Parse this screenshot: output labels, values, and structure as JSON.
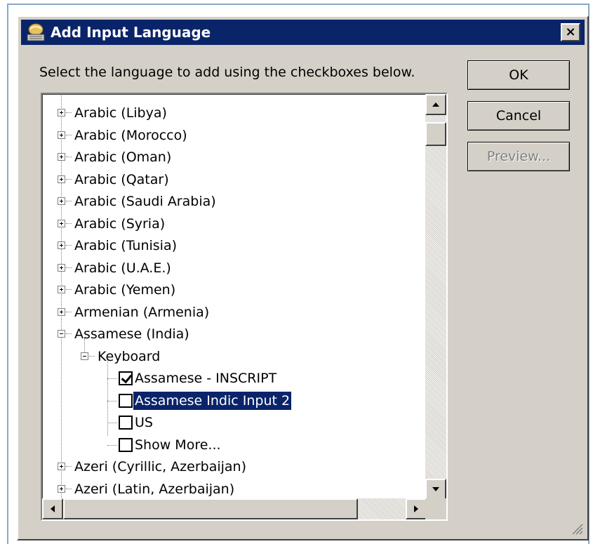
{
  "dialog": {
    "title": "Add Input Language",
    "close_glyph": "×",
    "instruction": "Select the language to add using the checkboxes below."
  },
  "buttons": {
    "ok": "OK",
    "cancel": "Cancel",
    "preview": "Preview..."
  },
  "tree": {
    "items": [
      {
        "label": "Arabic (Libya)",
        "expander": "plus"
      },
      {
        "label": "Arabic (Morocco)",
        "expander": "plus"
      },
      {
        "label": "Arabic (Oman)",
        "expander": "plus"
      },
      {
        "label": "Arabic (Qatar)",
        "expander": "plus"
      },
      {
        "label": "Arabic (Saudi Arabia)",
        "expander": "plus"
      },
      {
        "label": "Arabic (Syria)",
        "expander": "plus"
      },
      {
        "label": "Arabic (Tunisia)",
        "expander": "plus"
      },
      {
        "label": "Arabic (U.A.E.)",
        "expander": "plus"
      },
      {
        "label": "Arabic (Yemen)",
        "expander": "plus"
      },
      {
        "label": "Armenian (Armenia)",
        "expander": "plus"
      },
      {
        "label": "Assamese (India)",
        "expander": "minus"
      },
      {
        "label": "Keyboard",
        "expander": "minus"
      },
      {
        "label": "Assamese - INSCRIPT",
        "checked": true
      },
      {
        "label": "Assamese Indic Input 2",
        "checked": false,
        "selected": true
      },
      {
        "label": "US",
        "checked": false
      },
      {
        "label": "Show More...",
        "checked": false
      },
      {
        "label": "Azeri (Cyrillic, Azerbaijan)",
        "expander": "plus"
      },
      {
        "label": "Azeri (Latin, Azerbaijan)",
        "expander": "plus"
      }
    ]
  },
  "colors": {
    "titlebar": "#0a246a",
    "selection": "#0a246a",
    "face": "#d4d0c8"
  },
  "icons": {
    "title": "keyboard-globe-icon",
    "close": "close-icon",
    "grip": "resize-grip-icon"
  }
}
